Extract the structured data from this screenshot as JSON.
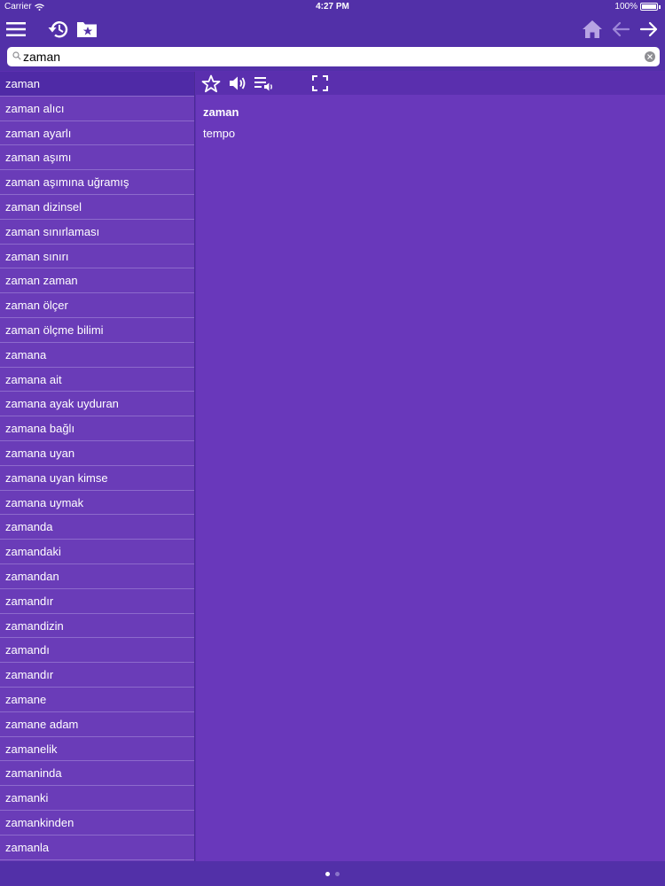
{
  "status_bar": {
    "carrier": "Carrier",
    "time": "4:27 PM",
    "battery": "100%"
  },
  "toolbar": {
    "icons": [
      "menu-icon",
      "history-icon",
      "favorites-folder-icon",
      "home-icon",
      "back-arrow-icon",
      "forward-arrow-icon"
    ]
  },
  "search": {
    "value": "zaman",
    "placeholder": ""
  },
  "word_list": {
    "selected_index": 0,
    "items": [
      "zaman",
      "zaman alıcı",
      "zaman ayarlı",
      "zaman aşımı",
      "zaman aşımına uğramış",
      "zaman dizinsel",
      "zaman sınırlaması",
      "zaman sınırı",
      "zaman zaman",
      "zaman ölçer",
      "zaman ölçme bilimi",
      "zamana",
      "zamana ait",
      "zamana ayak uyduran",
      "zamana bağlı",
      "zamana uyan",
      "zamana uyan kimse",
      "zamana uymak",
      "zamanda",
      "zamandaki",
      "zamandan",
      "zamandır",
      "zamandizin",
      "zamandı",
      "zamandır",
      "zamane",
      "zamane adam",
      "zamanelik",
      "zamaninda",
      "zamanki",
      "zamankinden",
      "zamanla"
    ]
  },
  "detail": {
    "toolbar_icons": [
      "star-icon",
      "speaker-icon",
      "playlist-audio-icon",
      "fullscreen-icon"
    ],
    "headword": "zaman",
    "translation": "tempo"
  },
  "pagination": {
    "pages": 2,
    "current": 1
  },
  "colors": {
    "bar": "#5230a8",
    "list_bg": "#6a3cb8",
    "detail_bg": "#6938bb",
    "selected": "#4f2aa6"
  }
}
